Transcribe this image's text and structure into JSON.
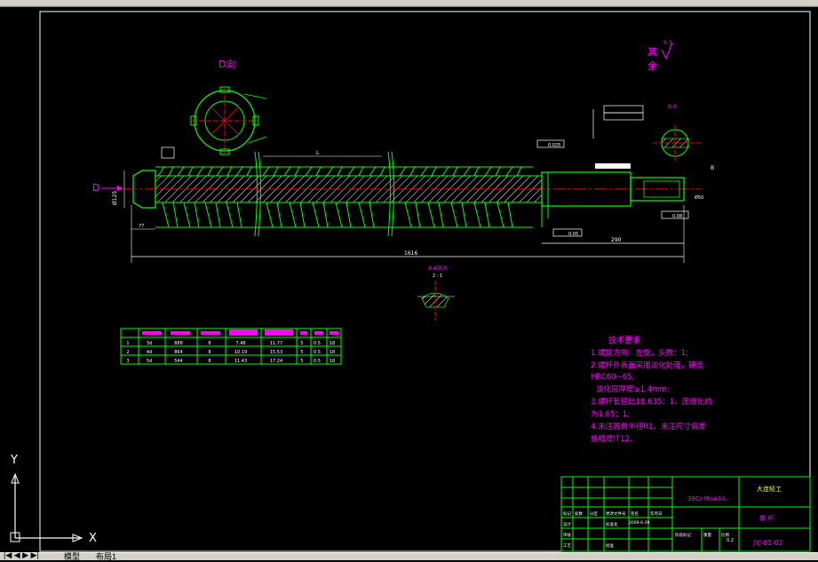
{
  "drawing": {
    "view_label_d": "D向",
    "arrow_label_d": "D",
    "other_surfaces": {
      "line1": "其",
      "line2": "余",
      "roughness": "6.3"
    },
    "section_aa": {
      "title": "A-A放大",
      "scale": "2 : 1"
    },
    "section_bb": "B-B",
    "dims": {
      "overall_length": "1616",
      "shank_length": "290",
      "diameter": "Ø125",
      "shank_small": "Ø50",
      "start_len": "77",
      "pitch": "L",
      "tol1": "0.025",
      "tol2": "0.05",
      "tol3": "0.08"
    }
  },
  "params_table": {
    "rows": [
      [
        "1",
        "3d",
        "888",
        "8",
        "7.48",
        "11.77",
        "5",
        "0.5",
        "18"
      ],
      [
        "2",
        "4d",
        "864",
        "8",
        "10.19",
        "15.53",
        "5",
        "0.5",
        "18"
      ],
      [
        "3",
        "5d",
        "544",
        "8",
        "11.43",
        "17.24",
        "5",
        "0.5",
        "18"
      ]
    ]
  },
  "tech_requirements": {
    "title": "技术要求",
    "lines": [
      "1.螺旋方向：左旋，头数：1;",
      "2.螺杆外表面采用淡化处理，硬度",
      "HRC60~65,",
      "淡化层厚度≥1.4mm;",
      "3.螺杆长径比18.635：1，压缩比约",
      "为1.65：1;",
      "4.未注圆角半径R1，未注尺寸偏差",
      "处精度IT12."
    ]
  },
  "title_block": {
    "material": "38Cr-MoA1A",
    "school": "大连轻工",
    "part_name": "螺  杆",
    "drawing_no": "JYJ-01-02",
    "scale": "0.2",
    "date": "2009-6-29",
    "small_labels": [
      "标记",
      "处数",
      "分区",
      "更改文件号",
      "签名",
      "年月日",
      "设计",
      "标准化",
      "审核",
      "工艺",
      "批准",
      "阶段标记",
      "重量",
      "比例"
    ]
  },
  "ucs": {
    "x_label": "X",
    "y_label": "Y"
  },
  "tabs": {
    "model": "模型",
    "layout": "布局1"
  },
  "colors": {
    "green": "#00ff00",
    "magenta": "#ff00ff",
    "red": "#ff0000",
    "white": "#ffffff",
    "yellow": "#ffff00"
  }
}
